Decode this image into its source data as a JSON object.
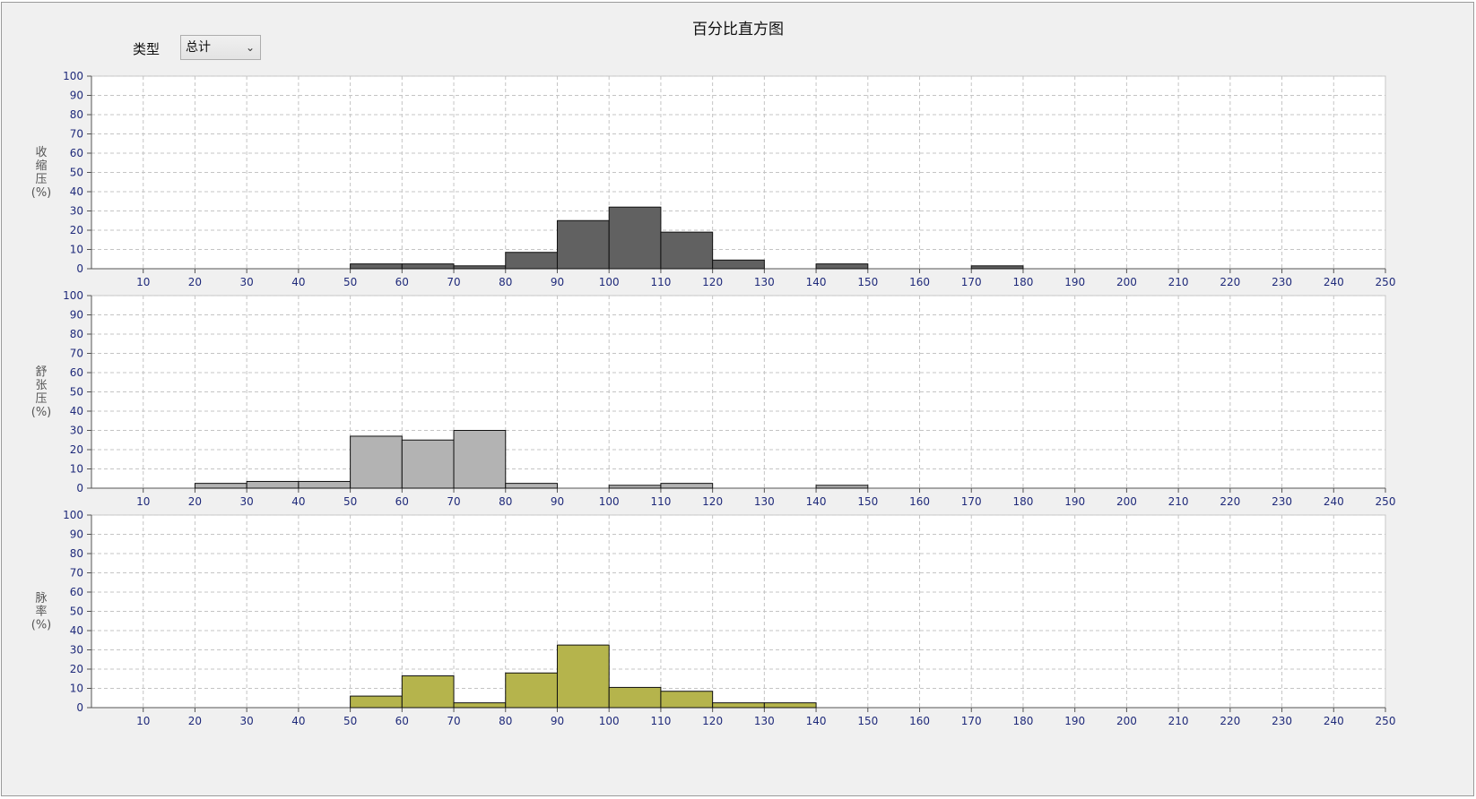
{
  "title": "百分比直方图",
  "controls": {
    "type_label": "类型",
    "type_value": "总计"
  },
  "chart_data": [
    {
      "type": "bar",
      "ylabel": "收缩压(%)",
      "ylabel_chars": [
        "收",
        "缩",
        "压",
        "(%)"
      ],
      "xlim": [
        0,
        250
      ],
      "ylim": [
        0,
        100
      ],
      "x_ticks": [
        10,
        20,
        30,
        40,
        50,
        60,
        70,
        80,
        90,
        100,
        110,
        120,
        130,
        140,
        150,
        160,
        170,
        180,
        190,
        200,
        210,
        220,
        230,
        240,
        250
      ],
      "y_ticks": [
        0,
        10,
        20,
        30,
        40,
        50,
        60,
        70,
        80,
        90,
        100
      ],
      "grid": true,
      "color": "#616161",
      "bins": [
        {
          "x0": 50,
          "x1": 60,
          "value": 2.5
        },
        {
          "x0": 60,
          "x1": 70,
          "value": 2.5
        },
        {
          "x0": 70,
          "x1": 80,
          "value": 1.5
        },
        {
          "x0": 80,
          "x1": 90,
          "value": 8.5
        },
        {
          "x0": 90,
          "x1": 100,
          "value": 25
        },
        {
          "x0": 100,
          "x1": 110,
          "value": 32
        },
        {
          "x0": 110,
          "x1": 120,
          "value": 19
        },
        {
          "x0": 120,
          "x1": 130,
          "value": 4.5
        },
        {
          "x0": 140,
          "x1": 150,
          "value": 2.5
        },
        {
          "x0": 170,
          "x1": 180,
          "value": 1.5
        }
      ]
    },
    {
      "type": "bar",
      "ylabel": "舒张压(%)",
      "ylabel_chars": [
        "舒",
        "张",
        "压",
        "(%)"
      ],
      "xlim": [
        0,
        250
      ],
      "ylim": [
        0,
        100
      ],
      "x_ticks": [
        10,
        20,
        30,
        40,
        50,
        60,
        70,
        80,
        90,
        100,
        110,
        120,
        130,
        140,
        150,
        160,
        170,
        180,
        190,
        200,
        210,
        220,
        230,
        240,
        250
      ],
      "y_ticks": [
        0,
        10,
        20,
        30,
        40,
        50,
        60,
        70,
        80,
        90,
        100
      ],
      "grid": true,
      "color": "#b3b3b3",
      "bins": [
        {
          "x0": 20,
          "x1": 30,
          "value": 2.5
        },
        {
          "x0": 30,
          "x1": 40,
          "value": 3.5
        },
        {
          "x0": 40,
          "x1": 50,
          "value": 3.5
        },
        {
          "x0": 50,
          "x1": 60,
          "value": 27
        },
        {
          "x0": 60,
          "x1": 70,
          "value": 25
        },
        {
          "x0": 70,
          "x1": 80,
          "value": 30
        },
        {
          "x0": 80,
          "x1": 90,
          "value": 2.5
        },
        {
          "x0": 100,
          "x1": 110,
          "value": 1.5
        },
        {
          "x0": 110,
          "x1": 120,
          "value": 2.5
        },
        {
          "x0": 140,
          "x1": 150,
          "value": 1.5
        }
      ]
    },
    {
      "type": "bar",
      "ylabel": "脉率(%)",
      "ylabel_chars": [
        "脉",
        "率",
        "(%)"
      ],
      "xlim": [
        0,
        250
      ],
      "ylim": [
        0,
        100
      ],
      "x_ticks": [
        10,
        20,
        30,
        40,
        50,
        60,
        70,
        80,
        90,
        100,
        110,
        120,
        130,
        140,
        150,
        160,
        170,
        180,
        190,
        200,
        210,
        220,
        230,
        240,
        250
      ],
      "y_ticks": [
        0,
        10,
        20,
        30,
        40,
        50,
        60,
        70,
        80,
        90,
        100
      ],
      "grid": true,
      "color": "#b5b44c",
      "bins": [
        {
          "x0": 50,
          "x1": 60,
          "value": 6
        },
        {
          "x0": 60,
          "x1": 70,
          "value": 16.5
        },
        {
          "x0": 70,
          "x1": 80,
          "value": 2.5
        },
        {
          "x0": 80,
          "x1": 90,
          "value": 18
        },
        {
          "x0": 90,
          "x1": 100,
          "value": 32.5
        },
        {
          "x0": 100,
          "x1": 110,
          "value": 10.5
        },
        {
          "x0": 110,
          "x1": 120,
          "value": 8.5
        },
        {
          "x0": 120,
          "x1": 130,
          "value": 2.5
        },
        {
          "x0": 130,
          "x1": 140,
          "value": 2.5
        }
      ]
    }
  ]
}
